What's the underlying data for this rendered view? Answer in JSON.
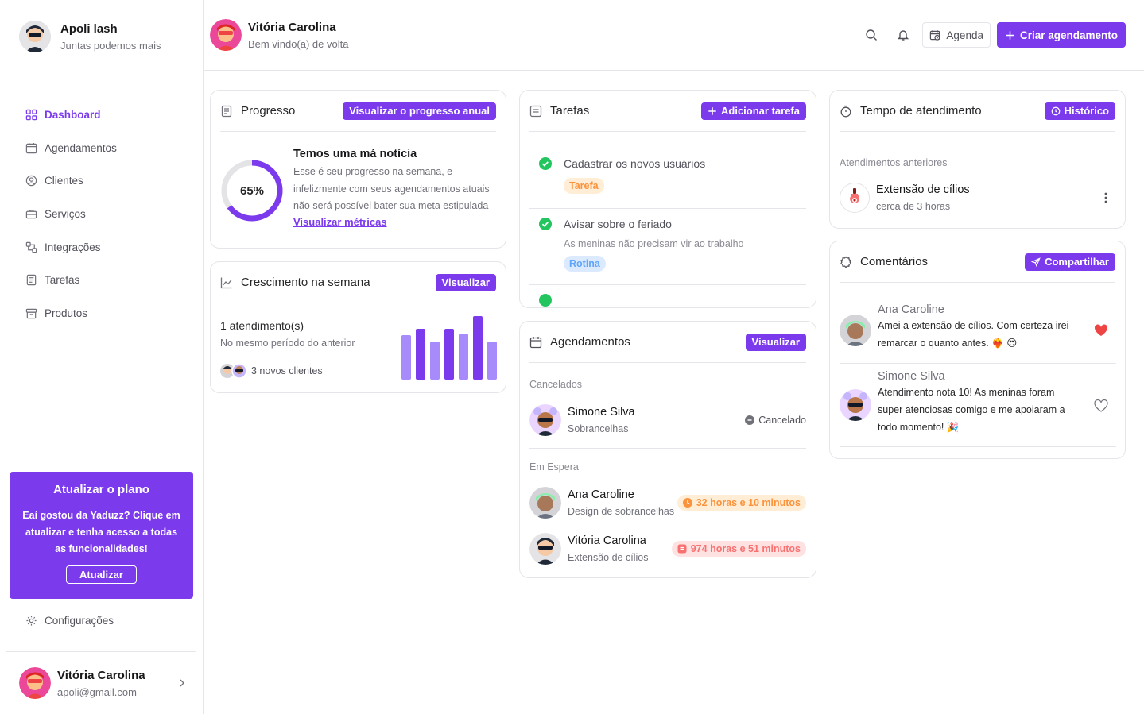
{
  "brand": {
    "name": "Apoli lash",
    "tagline": "Juntas podemos mais"
  },
  "nav": [
    {
      "label": "Dashboard",
      "icon": "dashboard-icon"
    },
    {
      "label": "Agendamentos",
      "icon": "calendar-icon"
    },
    {
      "label": "Clientes",
      "icon": "user-circle-icon"
    },
    {
      "label": "Serviços",
      "icon": "briefcase-icon"
    },
    {
      "label": "Integrações",
      "icon": "integration-icon"
    },
    {
      "label": "Tarefas",
      "icon": "list-icon"
    },
    {
      "label": "Produtos",
      "icon": "archive-icon"
    }
  ],
  "upgrade": {
    "title": "Atualizar o plano",
    "text": "Eaí gostou da Yaduzz? Clique em atualizar e tenha acesso a todas as funcionalidades!",
    "button": "Atualizar"
  },
  "settings_label": "Configurações",
  "user": {
    "name": "Vitória Carolina",
    "email": "apoli@gmail.com"
  },
  "header": {
    "name": "Vitória Carolina",
    "greeting": "Bem vindo(a) de volta",
    "agenda_label": "Agenda",
    "create_label": "Criar agendamento"
  },
  "progress": {
    "title": "Progresso",
    "button": "Visualizar o progresso anual",
    "percent_label": "65%",
    "percent": 65,
    "headline": "Temos uma má notícia",
    "text": "Esse é seu progresso na semana, e infelizmente com seus agendamentos atuais não será possível bater sua meta estipulada",
    "link": "Visualizar métricas"
  },
  "growth": {
    "title": "Crescimento na semana",
    "button": "Visualizar",
    "count": "1 atendimento(s)",
    "compare": "No mesmo período do anterior",
    "new_clients": "3 novos clientes",
    "bars": [
      0.7,
      0.8,
      0.6,
      0.8,
      0.72,
      1.0,
      0.6
    ]
  },
  "tasks": {
    "title": "Tarefas",
    "button": "Adicionar tarefa",
    "items": [
      {
        "title": "Cadastrar os novos usuários",
        "desc": "",
        "tag": "Tarefa"
      },
      {
        "title": "Avisar sobre o feriado",
        "desc": "As meninas não precisam vir ao trabalho",
        "tag": "Rotina"
      }
    ]
  },
  "appointments": {
    "title": "Agendamentos",
    "button": "Visualizar",
    "canceled_label": "Cancelados",
    "canceled": [
      {
        "name": "Simone Silva",
        "service": "Sobrancelhas",
        "status": "Cancelado"
      }
    ],
    "waiting_label": "Em Espera",
    "waiting": [
      {
        "name": "Ana Caroline",
        "service": "Design de sobrancelhas",
        "wait": "32 horas e 10 minutos"
      },
      {
        "name": "Vitória Carolina",
        "service": "Extensão de cílios",
        "wait": "974 horas e 51 minutos"
      }
    ]
  },
  "service_time": {
    "title": "Tempo de atendimento",
    "button": "Histórico",
    "section": "Atendimentos anteriores",
    "item": {
      "name": "Extensão de cílios",
      "time": "cerca de 3 horas"
    }
  },
  "comments": {
    "title": "Comentários",
    "button": "Compartilhar",
    "items": [
      {
        "name": "Ana Caroline",
        "text": "Amei a extensão de cílios. Com certeza irei remarcar o quanto antes.",
        "emoji": "❤️‍🔥 😍",
        "liked": true
      },
      {
        "name": "Simone Silva",
        "text": "Atendimento nota 10! As meninas foram super atenciosas comigo e me apoiaram a todo momento!",
        "emoji": "🎉",
        "liked": false
      }
    ]
  },
  "colors": {
    "accent": "#7c3aed",
    "bar_light": "#a78bfa",
    "bar_dark": "#7c3aed",
    "success": "#22c55e",
    "heart": "#ef4444"
  }
}
